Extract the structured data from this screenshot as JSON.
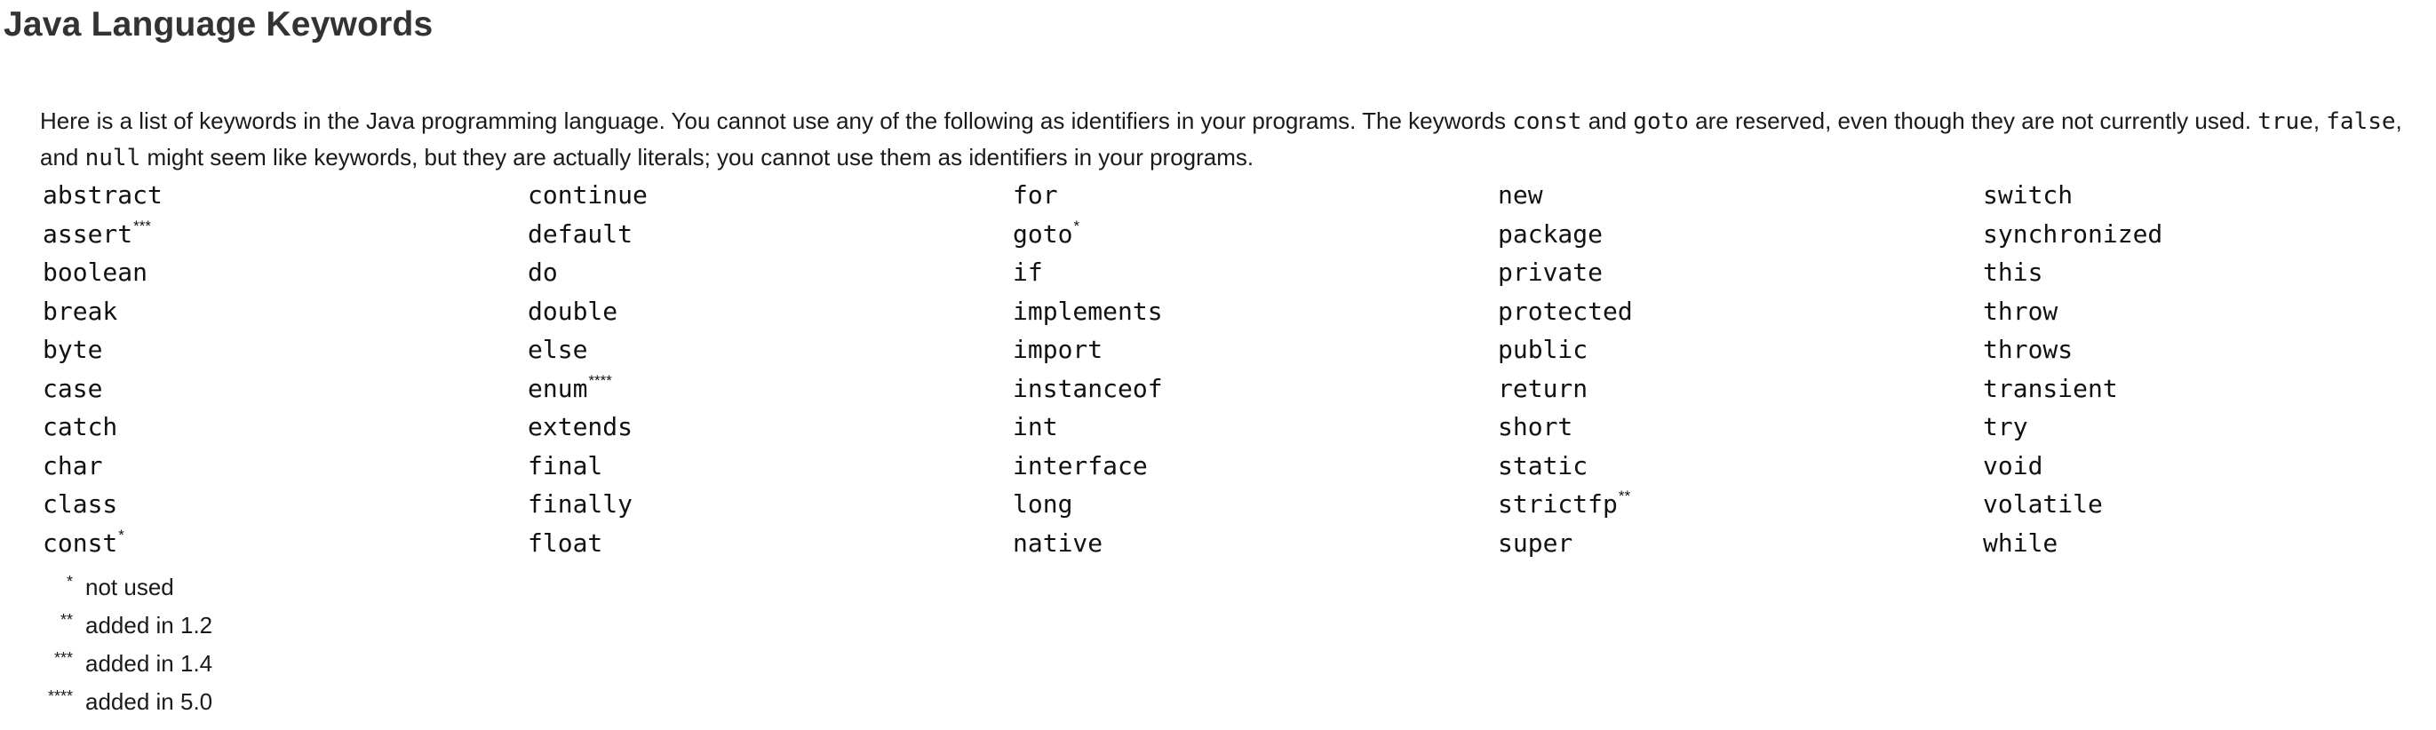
{
  "title": "Java Language Keywords",
  "intro": {
    "p1": "Here is a list of keywords in the Java programming language. You cannot use any of the following as identifiers in your programs. The keywords ",
    "c1": "const",
    "p2": " and ",
    "c2": "goto",
    "p3": " are reserved, even though they are not currently used. ",
    "c3": "true",
    "p4": ", ",
    "c4": "false",
    "p5": ", and ",
    "c5": "null",
    "p6": " might seem like keywords, but they are actually literals; you cannot use them as identifiers in your programs."
  },
  "keywords": [
    {
      "word": "abstract",
      "mark": ""
    },
    {
      "word": "continue",
      "mark": ""
    },
    {
      "word": "for",
      "mark": ""
    },
    {
      "word": "new",
      "mark": ""
    },
    {
      "word": "switch",
      "mark": ""
    },
    {
      "word": "assert",
      "mark": "***"
    },
    {
      "word": "default",
      "mark": ""
    },
    {
      "word": "goto",
      "mark": "*"
    },
    {
      "word": "package",
      "mark": ""
    },
    {
      "word": "synchronized",
      "mark": ""
    },
    {
      "word": "boolean",
      "mark": ""
    },
    {
      "word": "do",
      "mark": ""
    },
    {
      "word": "if",
      "mark": ""
    },
    {
      "word": "private",
      "mark": ""
    },
    {
      "word": "this",
      "mark": ""
    },
    {
      "word": "break",
      "mark": ""
    },
    {
      "word": "double",
      "mark": ""
    },
    {
      "word": "implements",
      "mark": ""
    },
    {
      "word": "protected",
      "mark": ""
    },
    {
      "word": "throw",
      "mark": ""
    },
    {
      "word": "byte",
      "mark": ""
    },
    {
      "word": "else",
      "mark": ""
    },
    {
      "word": "import",
      "mark": ""
    },
    {
      "word": "public",
      "mark": ""
    },
    {
      "word": "throws",
      "mark": ""
    },
    {
      "word": "case",
      "mark": ""
    },
    {
      "word": "enum",
      "mark": "****"
    },
    {
      "word": "instanceof",
      "mark": ""
    },
    {
      "word": "return",
      "mark": ""
    },
    {
      "word": "transient",
      "mark": ""
    },
    {
      "word": "catch",
      "mark": ""
    },
    {
      "word": "extends",
      "mark": ""
    },
    {
      "word": "int",
      "mark": ""
    },
    {
      "word": "short",
      "mark": ""
    },
    {
      "word": "try",
      "mark": ""
    },
    {
      "word": "char",
      "mark": ""
    },
    {
      "word": "final",
      "mark": ""
    },
    {
      "word": "interface",
      "mark": ""
    },
    {
      "word": "static",
      "mark": ""
    },
    {
      "word": "void",
      "mark": ""
    },
    {
      "word": "class",
      "mark": ""
    },
    {
      "word": "finally",
      "mark": ""
    },
    {
      "word": "long",
      "mark": ""
    },
    {
      "word": "strictfp",
      "mark": "**"
    },
    {
      "word": "volatile",
      "mark": ""
    },
    {
      "word": "const",
      "mark": "*"
    },
    {
      "word": "float",
      "mark": ""
    },
    {
      "word": "native",
      "mark": ""
    },
    {
      "word": "super",
      "mark": ""
    },
    {
      "word": "while",
      "mark": ""
    }
  ],
  "notes": [
    {
      "mark": "*",
      "text": "not used"
    },
    {
      "mark": "**",
      "text": "added in 1.2"
    },
    {
      "mark": "***",
      "text": "added in 1.4"
    },
    {
      "mark": "****",
      "text": "added in 5.0"
    }
  ]
}
